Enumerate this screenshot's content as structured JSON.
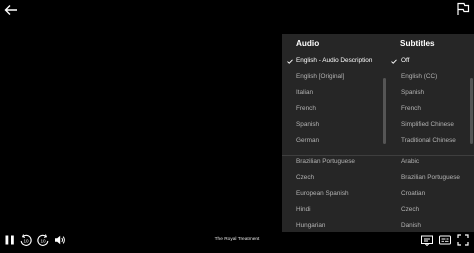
{
  "audio": {
    "title": "Audio",
    "options": [
      {
        "label": "English - Audio Description",
        "selected": true
      },
      {
        "label": "English [Original]",
        "selected": false
      },
      {
        "label": "Italian",
        "selected": false
      },
      {
        "label": "French",
        "selected": false
      },
      {
        "label": "Spanish",
        "selected": false
      },
      {
        "label": "German",
        "selected": false
      },
      {
        "label": "Brazilian Portuguese",
        "selected": false
      },
      {
        "label": "Czech",
        "selected": false
      },
      {
        "label": "European Spanish",
        "selected": false
      },
      {
        "label": "Hindi",
        "selected": false
      },
      {
        "label": "Hungarian",
        "selected": false
      }
    ]
  },
  "subtitles": {
    "title": "Subtitles",
    "options": [
      {
        "label": "Off",
        "selected": true
      },
      {
        "label": "English (CC)",
        "selected": false
      },
      {
        "label": "Spanish",
        "selected": false
      },
      {
        "label": "French",
        "selected": false
      },
      {
        "label": "Simplified Chinese",
        "selected": false
      },
      {
        "label": "Traditional Chinese",
        "selected": false
      },
      {
        "label": "Arabic",
        "selected": false
      },
      {
        "label": "Brazilian Portuguese",
        "selected": false
      },
      {
        "label": "Croatian",
        "selected": false
      },
      {
        "label": "Czech",
        "selected": false
      },
      {
        "label": "Danish",
        "selected": false
      }
    ]
  },
  "player": {
    "title": "The Royal Treatment",
    "seek_back_seconds": "10",
    "seek_forward_seconds": "10"
  },
  "icons": {
    "back": "arrow-left-icon",
    "report": "flag-icon",
    "play_pause": "pause-icon",
    "seek_back": "rewind-10-icon",
    "seek_forward": "forward-10-icon",
    "volume": "volume-icon",
    "episodes": "next-episode-icon",
    "subtitles": "subtitles-icon",
    "speed": "speed-icon",
    "fullscreen": "fullscreen-icon"
  },
  "colors": {
    "panel_bg": "#262626",
    "text_selected": "#ffffff",
    "text_option": "#b3b3b3",
    "background": "#000000"
  }
}
